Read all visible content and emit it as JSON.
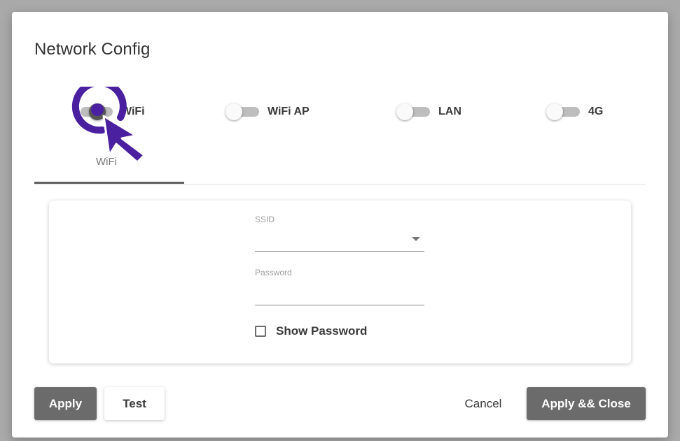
{
  "dialog": {
    "title": "Network Config"
  },
  "toggles": [
    {
      "label": "WiFi",
      "on": true
    },
    {
      "label": "WiFi AP",
      "on": false
    },
    {
      "label": "LAN",
      "on": false
    },
    {
      "label": "4G",
      "on": false
    }
  ],
  "tabs": {
    "active_label": "WiFi"
  },
  "form": {
    "ssid_label": "SSID",
    "ssid_value": "",
    "password_label": "Password",
    "password_value": "",
    "show_password_label": "Show Password",
    "show_password_checked": false
  },
  "actions": {
    "apply_label": "Apply",
    "test_label": "Test",
    "cancel_label": "Cancel",
    "apply_close_label": "Apply && Close"
  },
  "colors": {
    "accent": "#4a1fa0",
    "button_dark": "#6b6b6b",
    "toggle_on_knob": "#555555"
  },
  "icons": [
    "click-cursor-icon",
    "dropdown-caret-icon"
  ]
}
